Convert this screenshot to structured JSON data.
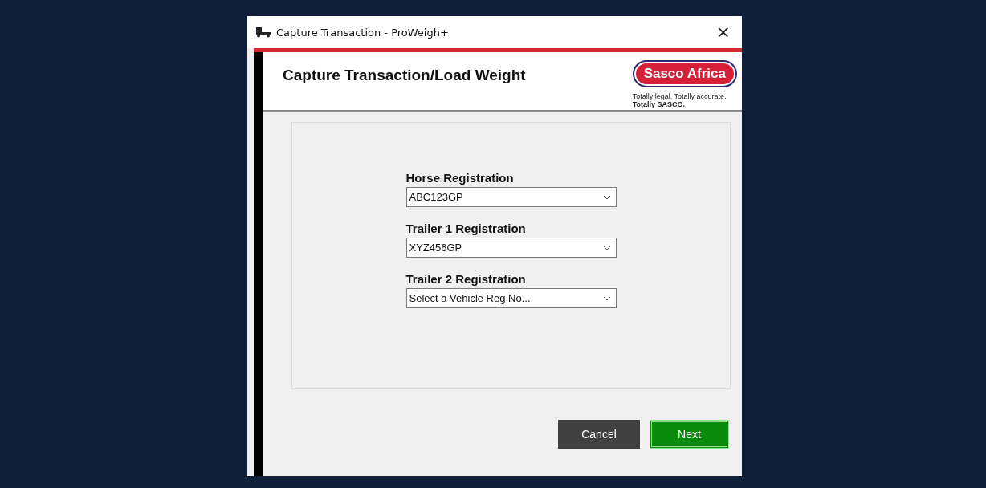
{
  "window": {
    "title": "Capture Transaction - ProWeigh+",
    "close": "×"
  },
  "header": {
    "title": "Capture Transaction/Load Weight",
    "logo": "Sasco Africa",
    "tagline": "Totally legal. Totally accurate.",
    "tagline_bold": "Totally SASCO."
  },
  "fields": [
    {
      "label": "Horse Registration",
      "value": "ABC123GP"
    },
    {
      "label": "Trailer 1 Registration",
      "value": "XYZ456GP"
    },
    {
      "label": "Trailer 2 Registration",
      "placeholder": "Select a Vehicle Reg No..."
    }
  ],
  "buttons": [
    {
      "label": "Cancel",
      "kind": "secondary"
    },
    {
      "label": "Next",
      "kind": "primary"
    }
  ]
}
